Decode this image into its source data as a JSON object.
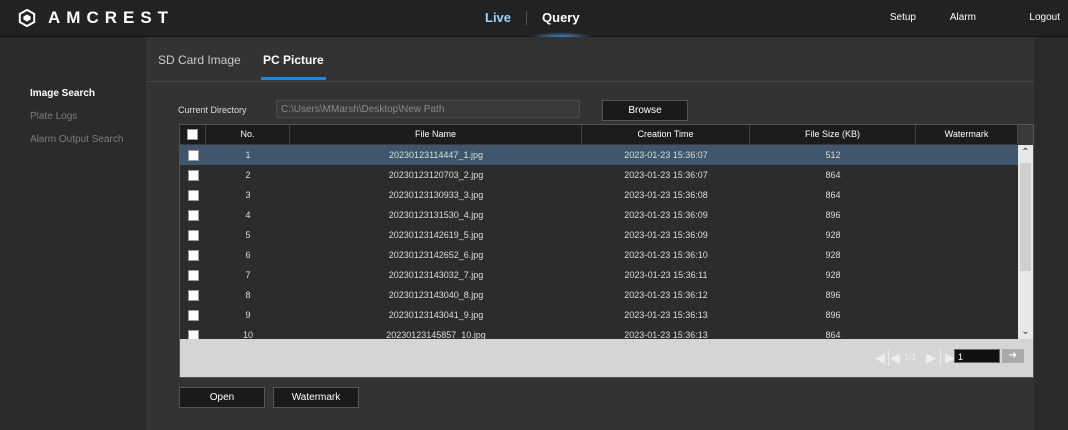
{
  "brand": {
    "name": "AMCREST",
    "logo_icon": "amcrest-logo-icon"
  },
  "topnav": {
    "live": "Live",
    "query": "Query"
  },
  "topright": {
    "setup": "Setup",
    "alarm": "Alarm",
    "logout": "Logout"
  },
  "sidebar": {
    "items": [
      {
        "label": "Image Search",
        "active": true
      },
      {
        "label": "Plate Logs",
        "active": false
      },
      {
        "label": "Alarm Output Search",
        "active": false
      }
    ]
  },
  "tabs": {
    "sd": "SD Card Image",
    "pc": "PC Picture"
  },
  "directory": {
    "label": "Current Directory",
    "value": "C:\\Users\\MMarsh\\Desktop\\New Path",
    "browse": "Browse"
  },
  "table": {
    "headers": [
      "No.",
      "File Name",
      "Creation Time",
      "File Size (KB)",
      "Watermark"
    ],
    "rows": [
      {
        "no": "1",
        "name": "20230123114447_1.jpg",
        "time": "2023-01-23 15:36:07",
        "size": "512",
        "watermark": ""
      },
      {
        "no": "2",
        "name": "20230123120703_2.jpg",
        "time": "2023-01-23 15:36:07",
        "size": "864",
        "watermark": ""
      },
      {
        "no": "3",
        "name": "20230123130933_3.jpg",
        "time": "2023-01-23 15:36:08",
        "size": "864",
        "watermark": ""
      },
      {
        "no": "4",
        "name": "20230123131530_4.jpg",
        "time": "2023-01-23 15:36:09",
        "size": "896",
        "watermark": ""
      },
      {
        "no": "5",
        "name": "20230123142619_5.jpg",
        "time": "2023-01-23 15:36:09",
        "size": "928",
        "watermark": ""
      },
      {
        "no": "6",
        "name": "20230123142652_6.jpg",
        "time": "2023-01-23 15:36:10",
        "size": "928",
        "watermark": ""
      },
      {
        "no": "7",
        "name": "20230123143032_7.jpg",
        "time": "2023-01-23 15:36:11",
        "size": "928",
        "watermark": ""
      },
      {
        "no": "8",
        "name": "20230123143040_8.jpg",
        "time": "2023-01-23 15:36:12",
        "size": "896",
        "watermark": ""
      },
      {
        "no": "9",
        "name": "20230123143041_9.jpg",
        "time": "2023-01-23 15:36:13",
        "size": "896",
        "watermark": ""
      },
      {
        "no": "10",
        "name": "20230123145857_10.jpg",
        "time": "2023-01-23 15:36:13",
        "size": "864",
        "watermark": ""
      }
    ]
  },
  "pager": {
    "count": "1/1",
    "page": "1"
  },
  "buttons": {
    "open": "Open",
    "watermark": "Watermark"
  },
  "colors": {
    "selected_row": "#3f566c",
    "accent": "#1e88e5",
    "topnav_link": "#9fd0ff"
  }
}
